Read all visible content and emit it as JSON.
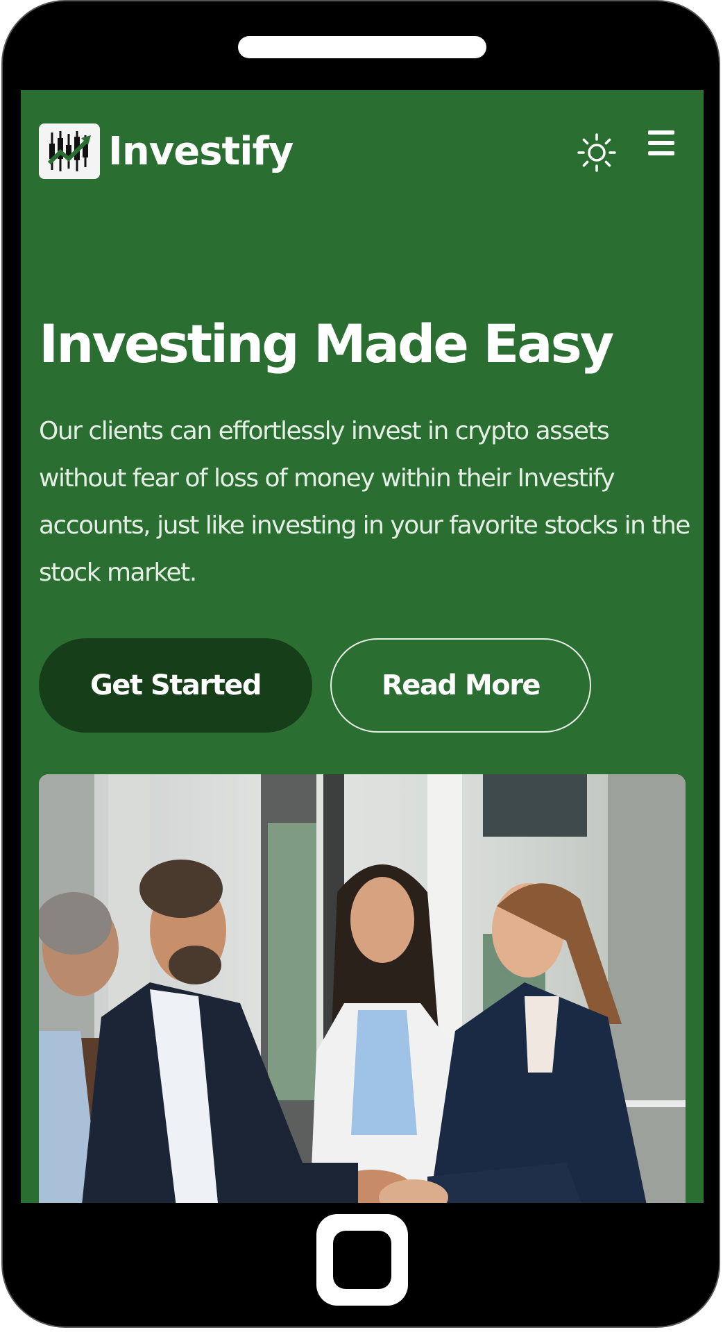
{
  "brand": {
    "name": "Investify",
    "logo_icon": "candlestick-chart-icon"
  },
  "header": {
    "theme_toggle_icon": "sun-icon",
    "menu_icon": "hamburger-menu-icon"
  },
  "hero": {
    "title": "Investing Made Easy",
    "description": "Our clients can effortlessly invest in crypto assets without fear of loss of money within their Investify accounts, just like investing in your favorite stocks in the stock market.",
    "primary_button": "Get Started",
    "secondary_button": "Read More"
  },
  "colors": {
    "background": "#2a6f31",
    "primary_button": "#163e18",
    "text": "#ffffff"
  }
}
